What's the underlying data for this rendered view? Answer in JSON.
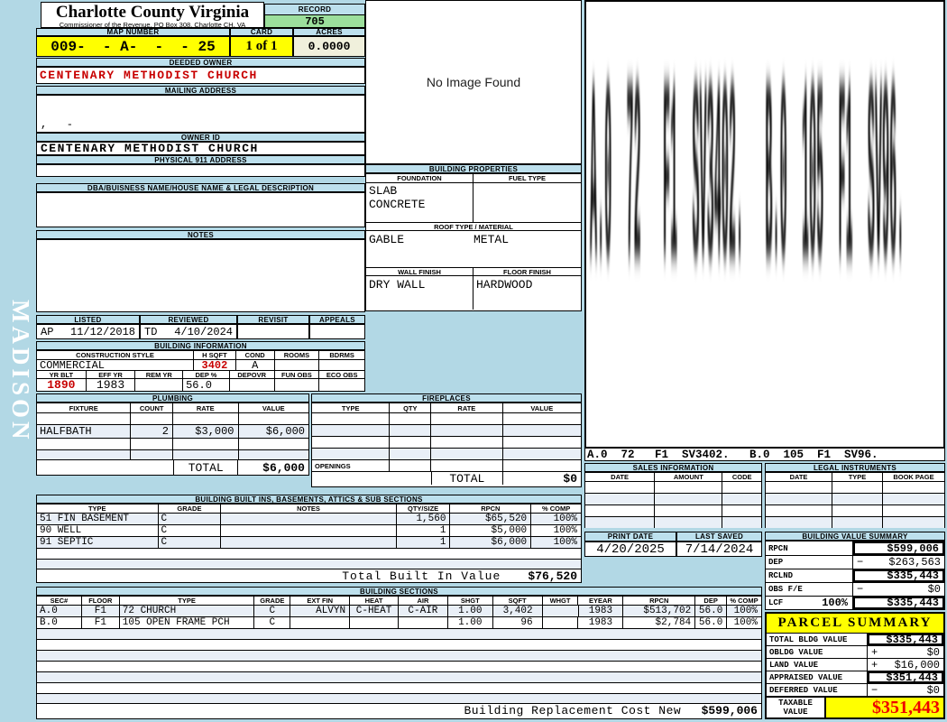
{
  "watermark": "MADISON",
  "header": {
    "county": "Charlotte County Virginia",
    "commissioner": "Commissioner of the Revenue, PO Box 308, Charlotte CH, VA",
    "record_label": "RECORD",
    "record_value": "705",
    "map_number_label": "MAP NUMBER",
    "map_number": "009-  - A-  -  - 25",
    "card_label": "CARD",
    "card_value": "1 of 1",
    "acres_label": "ACRES",
    "acres_value": "0.0000"
  },
  "owner": {
    "deeded_owner_label": "DEEDED OWNER",
    "deeded_owner": "CENTENARY METHODIST CHURCH",
    "mailing_address_label": "MAILING ADDRESS",
    "mailing_address": ",   -",
    "owner_id_label": "OWNER ID",
    "owner_id": "CENTENARY METHODIST CHURCH",
    "physical_911_label": "PHYSICAL 911 ADDRESS",
    "physical_911": "",
    "dba_label": "DBA/BUISNESS NAME/HOUSE NAME & LEGAL DESCRIPTION",
    "dba": "",
    "notes_label": "NOTES",
    "notes": ""
  },
  "photo": {
    "placeholder": "No Image Found"
  },
  "properties": {
    "title": "BUILDING PROPERTIES",
    "foundation_label": "FOUNDATION",
    "foundation_line1": "SLAB",
    "foundation_line2": "CONCRETE",
    "fuel_type_label": "FUEL TYPE",
    "fuel_type": "",
    "roof_label": "ROOF TYPE / MATERIAL",
    "roof_type": "GABLE",
    "roof_material": "METAL",
    "wall_finish_label": "WALL FINISH",
    "wall_finish": "DRY WALL",
    "floor_finish_label": "FLOOR FINISH",
    "floor_finish": "HARDWOOD"
  },
  "review": {
    "listed_label": "LISTED",
    "listed_code": "AP",
    "listed_date": "11/12/2018",
    "reviewed_label": "REVIEWED",
    "reviewed_code": "TD",
    "reviewed_date": "4/10/2024",
    "revisit_label": "REVISIT",
    "revisit": "",
    "appeals_label": "APPEALS",
    "appeals": ""
  },
  "building_info": {
    "title": "BUILDING INFORMATION",
    "construction_style_label": "CONSTRUCTION STYLE",
    "construction_style": "COMMERCIAL",
    "hsqft_label": "H SQFT",
    "hsqft": "3402",
    "cond_label": "COND",
    "cond": "A",
    "rooms_label": "ROOMS",
    "rooms": "",
    "bdrms_label": "BDRMS",
    "bdrms": "",
    "yr_blt_label": "YR BLT",
    "yr_blt": "1890",
    "eff_yr_label": "EFF YR",
    "eff_yr": "1983",
    "rem_yr_label": "REM YR",
    "rem_yr": "",
    "dep_label": "DEP %",
    "dep": "56.0",
    "depovr_label": "DEPOVR",
    "depovr": "",
    "fun_obs_label": "FUN OBS",
    "fun_obs": "",
    "eco_obs_label": "ECO OBS",
    "eco_obs": ""
  },
  "plumbing": {
    "title": "PLUMBING",
    "headers": [
      "FIXTURE",
      "COUNT",
      "RATE",
      "VALUE"
    ],
    "rows": [
      {
        "fixture": "",
        "count": "",
        "rate": "",
        "value": ""
      },
      {
        "fixture": "HALFBATH",
        "count": "2",
        "rate": "$3,000",
        "value": "$6,000"
      },
      {
        "fixture": "",
        "count": "",
        "rate": "",
        "value": ""
      },
      {
        "fixture": "",
        "count": "",
        "rate": "",
        "value": ""
      }
    ],
    "total_label": "TOTAL",
    "total_value": "$6,000"
  },
  "fireplaces": {
    "title": "FIREPLACES",
    "headers": [
      "TYPE",
      "QTY",
      "RATE",
      "VALUE"
    ],
    "openings_label": "OPENINGS",
    "total_label": "TOTAL",
    "total_value": "$0"
  },
  "builtins": {
    "title": "BUILDING BUILT INS, BASEMENTS, ATTICS & SUB SECTIONS",
    "headers": [
      "TYPE",
      "GRADE",
      "NOTES",
      "QTY/SIZE",
      "RPCN",
      "% COMP"
    ],
    "rows": [
      {
        "type": "51 FIN BASEMENT",
        "grade": "C",
        "notes": "",
        "qty": "1,560",
        "rpcn": "$65,520",
        "comp": "100%"
      },
      {
        "type": "90 WELL",
        "grade": "C",
        "notes": "",
        "qty": "1",
        "rpcn": "$5,000",
        "comp": "100%"
      },
      {
        "type": "91 SEPTIC",
        "grade": "C",
        "notes": "",
        "qty": "1",
        "rpcn": "$6,000",
        "comp": "100%"
      }
    ],
    "total_label": "Total Built In Value",
    "total_value": "$76,520"
  },
  "sections": {
    "title": "BUILDING SECTIONS",
    "headers": [
      "SEC#",
      "FLOOR",
      "TYPE",
      "GRADE",
      "EXT FIN",
      "HEAT",
      "AIR",
      "SHGT",
      "SQFT",
      "WHGT",
      "EYEAR",
      "RPCN",
      "DEP",
      "% COMP"
    ],
    "rows": [
      {
        "sec": "A.0",
        "floor": "F1",
        "type": "72 CHURCH",
        "grade": "C",
        "ext": "ALVYN",
        "heat": "C-HEAT",
        "air": "C-AIR",
        "shgt": "1.00",
        "sqft": "3,402",
        "whgt": "",
        "eyear": "1983",
        "rpcn": "$513,702",
        "dep": "56.0",
        "comp": "100%"
      },
      {
        "sec": "B.0",
        "floor": "F1",
        "type": "105 OPEN FRAME PCH",
        "grade": "C",
        "ext": "",
        "heat": "",
        "air": "",
        "shgt": "1.00",
        "sqft": "96",
        "whgt": "",
        "eyear": "1983",
        "rpcn": "$2,784",
        "dep": "56.0",
        "comp": "100%"
      }
    ],
    "rcn_label": "Building Replacement Cost New",
    "rcn_value": "$599,006"
  },
  "sketch": {
    "label": "A.0  72   F1  SV3402.   B.0  105  F1  SV96."
  },
  "sales": {
    "title": "SALES INFORMATION",
    "headers": [
      "DATE",
      "AMOUNT",
      "CODE"
    ]
  },
  "legal": {
    "title": "LEGAL INSTRUMENTS",
    "headers": [
      "DATE",
      "TYPE",
      "BOOK PAGE"
    ]
  },
  "dates": {
    "print_label": "PRINT DATE",
    "print_value": "4/20/2025",
    "saved_label": "LAST SAVED",
    "saved_value": "7/14/2024"
  },
  "value_summary": {
    "title": "BUILDING VALUE SUMMARY",
    "rows": [
      {
        "label": "RPCN",
        "pct": "",
        "sign": "",
        "value": "$599,006"
      },
      {
        "label": "DEP",
        "pct": "",
        "sign": "−",
        "value": "$263,563"
      },
      {
        "label": "RCLND",
        "pct": "",
        "sign": "",
        "value": "$335,443"
      },
      {
        "label": "OBS F/E",
        "pct": "",
        "sign": "−",
        "value": "$0"
      },
      {
        "label": "LCF",
        "pct": "100%",
        "sign": "",
        "value": "$335,443"
      }
    ]
  },
  "parcel": {
    "title": "PARCEL SUMMARY",
    "rows": [
      {
        "label": "TOTAL BLDG VALUE",
        "sign": "",
        "value": "$335,443"
      },
      {
        "label": "OBLDG VALUE",
        "sign": "+",
        "value": "$0"
      },
      {
        "label": "LAND VALUE",
        "sign": "+",
        "value": "$16,000"
      },
      {
        "label": "APPRAISED VALUE",
        "sign": "",
        "value": "$351,443"
      },
      {
        "label": "DEFERRED VALUE",
        "sign": "−",
        "value": "$0"
      }
    ],
    "taxable_label_line1": "TAXABLE",
    "taxable_label_line2": "VALUE",
    "taxable_value": "$351,443"
  },
  "colors": {
    "page_background": "#b2d8e5",
    "header_strip": "#bde0ed",
    "highlight_yellow": "#ffff00",
    "record_green": "#9cdf9c",
    "acres_cream": "#f0f0dc",
    "alert_red": "#c80000",
    "taxable_red": "#ee0000"
  }
}
